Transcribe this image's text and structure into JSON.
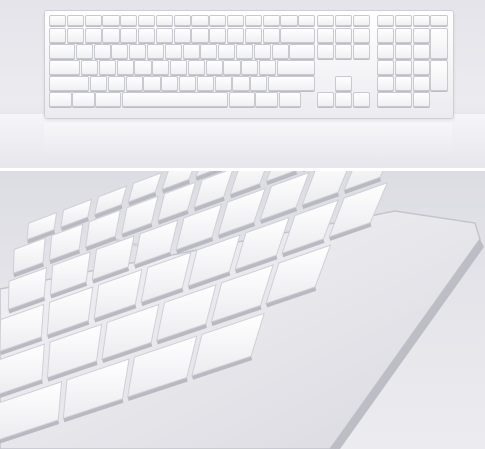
{
  "photo": {
    "subject": "keyboard-photo",
    "colors": {
      "background": "#e6e6ec",
      "keyboard": "#f7f7f9",
      "key_edge": "#c9c9d0",
      "shadow": "#b9b9c2"
    }
  }
}
